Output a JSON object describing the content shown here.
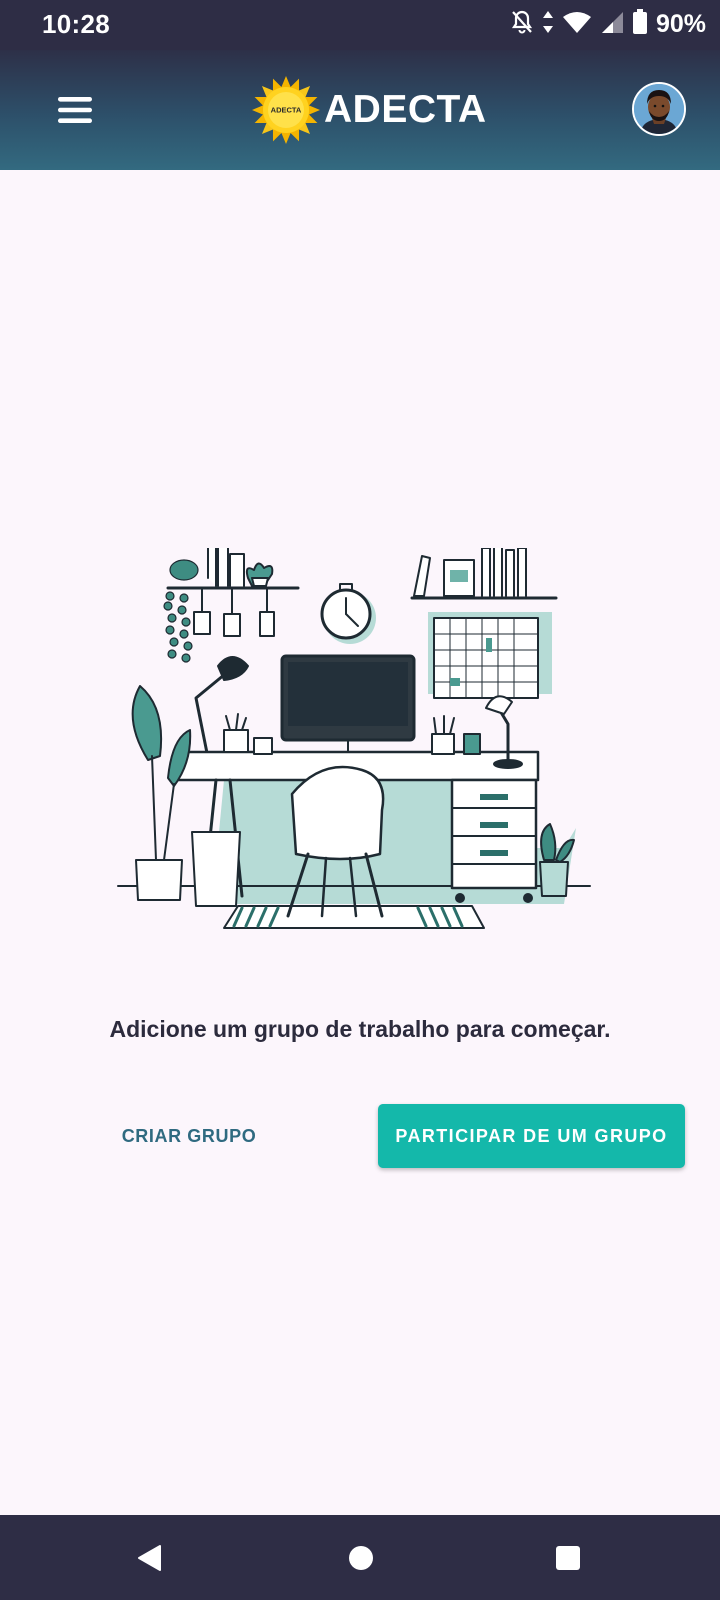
{
  "status_bar": {
    "time": "10:28",
    "battery": "90%"
  },
  "app_bar": {
    "title": "ADECTA",
    "logo_text": "ADECTA"
  },
  "main": {
    "empty_message": "Adicione um grupo de trabalho para começar.",
    "create_group_label": "CRIAR GRUPO",
    "join_group_label": "PARTICIPAR DE UM GRUPO"
  },
  "colors": {
    "accent": "#14b8aa",
    "app_bar_top": "#2d3048",
    "app_bar_bottom": "#336a80",
    "background": "#fcf6fc",
    "system_bars": "#2e2d45"
  },
  "icons": [
    "bell-off-icon",
    "data-arrows-icon",
    "wifi-icon",
    "cell-signal-icon",
    "battery-icon",
    "menu-icon",
    "avatar",
    "back-icon",
    "home-icon",
    "recents-icon"
  ]
}
